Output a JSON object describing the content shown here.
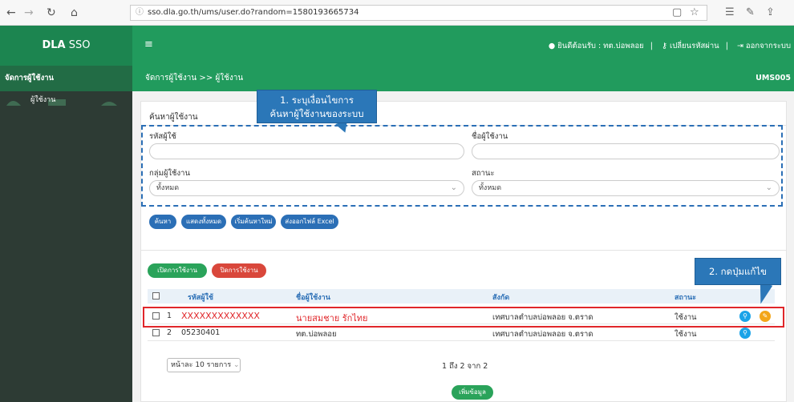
{
  "browser": {
    "url": "sso.dla.go.th/ums/user.do?random=1580193665734"
  },
  "topnav": {
    "brand_bold": "DLA",
    "brand_rest": " SSO",
    "menu_icon": "≡",
    "welcome": "ยินดีต้อนรับ : ทต.บ่อพลอย",
    "change_password": "เปลี่ยนรหัสผ่าน",
    "logout": "ออกจากระบบ"
  },
  "sidebar": {
    "items": [
      {
        "label": "จัดการผู้ใช้งาน"
      },
      {
        "label": "ผู้ใช้งาน"
      }
    ]
  },
  "header": {
    "breadcrumb": "จัดการผู้ใช้งาน >>  ผู้ใช้งาน",
    "code": "UMS005"
  },
  "search": {
    "title": "ค้นหาผู้ใช้งาน",
    "user_id_label": "รหัสผู้ใช้",
    "user_id_value": "",
    "user_name_label": "ชื่อผู้ใช้งาน",
    "user_name_value": "",
    "group_label": "กลุ่มผู้ใช้งาน",
    "group_value": "ทั้งหมด",
    "status_label": "สถานะ",
    "status_value": "ทั้งหมด",
    "buttons": {
      "search": "ค้นหา",
      "show_all": "แสดงทั้งหมด",
      "reset": "เริ่มค้นหาใหม่",
      "export": "ส่งออกไฟล์ Excel"
    }
  },
  "actions": {
    "enable": "เปิดการใช้งาน",
    "disable": "ปิดการใช้งาน",
    "add": "เพิ่มข้อมูล"
  },
  "table": {
    "headers": [
      "รหัสผู้ใช้",
      "ชื่อผู้ใช้งาน",
      "สังกัด",
      "สถานะ"
    ],
    "rows": [
      {
        "no": "1",
        "user_id": "XXXXXXXXXXXXX",
        "name": "นายสมชาย รักไทย",
        "org": "เทศบาลตำบลบ่อพลอย จ.ตราด",
        "status": "ใช้งาน"
      },
      {
        "no": "2",
        "user_id": "05230401",
        "name": "ทต.บ่อพลอย",
        "org": "เทศบาลตำบลบ่อพลอย จ.ตราด",
        "status": "ใช้งาน"
      }
    ]
  },
  "pagination": {
    "per_page": "หน้าละ 10 รายการ",
    "info": "1 ถึง 2 จาก 2"
  },
  "annotations": {
    "step1": "1. ระบุเงื่อนไขการ\nค้นหาผู้ใช้งานของระบบ",
    "step2": "2. กดปุ่มแก้ไข"
  },
  "colors": {
    "primary_green": "#219b5d",
    "accent_blue": "#2b6fb6",
    "highlight_red": "#e0262a"
  }
}
